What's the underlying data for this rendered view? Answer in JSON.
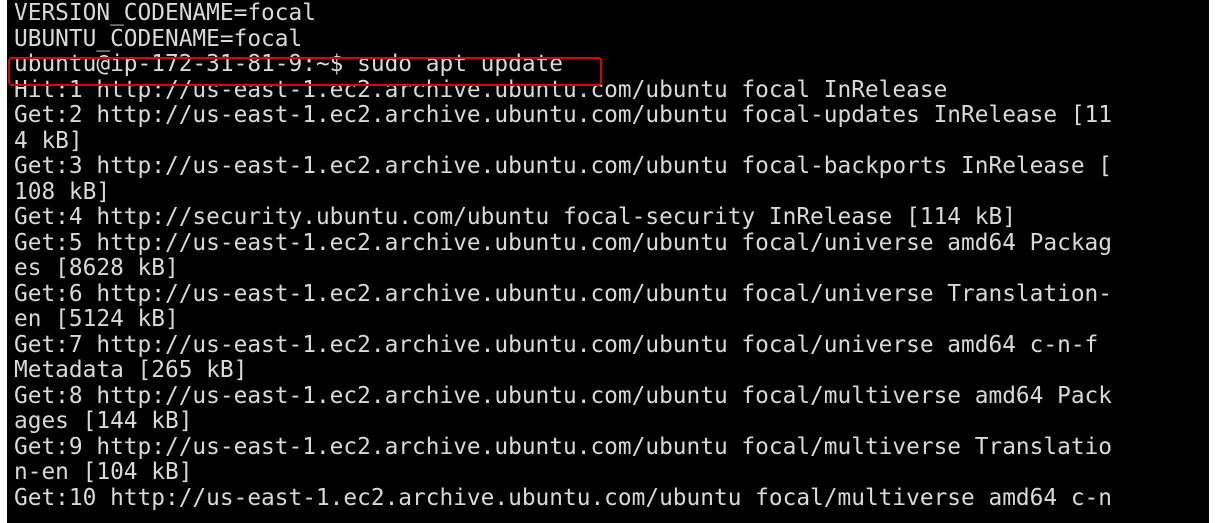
{
  "terminal": {
    "lines": [
      "VERSION_CODENAME=focal",
      "UBUNTU_CODENAME=focal",
      "ubuntu@ip-172-31-81-9:~$ sudo apt update",
      "Hit:1 http://us-east-1.ec2.archive.ubuntu.com/ubuntu focal InRelease",
      "Get:2 http://us-east-1.ec2.archive.ubuntu.com/ubuntu focal-updates InRelease [11",
      "4 kB]",
      "Get:3 http://us-east-1.ec2.archive.ubuntu.com/ubuntu focal-backports InRelease [",
      "108 kB]",
      "Get:4 http://security.ubuntu.com/ubuntu focal-security InRelease [114 kB]",
      "Get:5 http://us-east-1.ec2.archive.ubuntu.com/ubuntu focal/universe amd64 Packag",
      "es [8628 kB]",
      "Get:6 http://us-east-1.ec2.archive.ubuntu.com/ubuntu focal/universe Translation-",
      "en [5124 kB]",
      "Get:7 http://us-east-1.ec2.archive.ubuntu.com/ubuntu focal/universe amd64 c-n-f",
      "Metadata [265 kB]",
      "Get:8 http://us-east-1.ec2.archive.ubuntu.com/ubuntu focal/multiverse amd64 Pack",
      "ages [144 kB]",
      "Get:9 http://us-east-1.ec2.archive.ubuntu.com/ubuntu focal/multiverse Translatio",
      "n-en [104 kB]",
      "Get:10 http://us-east-1.ec2.archive.ubuntu.com/ubuntu focal/multiverse amd64 c-n"
    ]
  },
  "colors": {
    "background": "#000000",
    "text": "#d9d9d9",
    "highlight_border": "#e00000"
  }
}
